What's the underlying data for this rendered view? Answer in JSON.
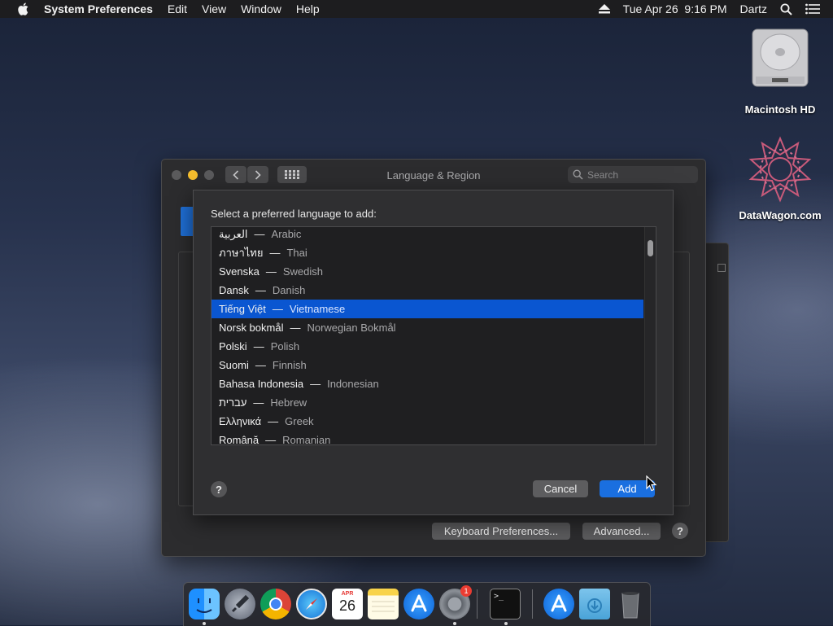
{
  "menubar": {
    "app_name": "System Preferences",
    "menus": [
      "Edit",
      "View",
      "Window",
      "Help"
    ],
    "datetime": "Tue Apr 26  9:16 PM",
    "user": "Dartz"
  },
  "desktop_icons": [
    {
      "label": "Macintosh HD",
      "icon": "hard-drive-icon"
    },
    {
      "label": "DataWagon.com",
      "icon": "datawagon-logo-icon"
    }
  ],
  "window": {
    "title": "Language & Region",
    "search_placeholder": "Search",
    "keyboard_prefs_label": "Keyboard Preferences...",
    "advanced_label": "Advanced...",
    "help_label": "?"
  },
  "sheet": {
    "prompt": "Select a preferred language to add:",
    "languages": [
      {
        "native": "العربية",
        "english": "Arabic"
      },
      {
        "native": "ภาษาไทย",
        "english": "Thai"
      },
      {
        "native": "Svenska",
        "english": "Swedish"
      },
      {
        "native": "Dansk",
        "english": "Danish"
      },
      {
        "native": "Tiếng Việt",
        "english": "Vietnamese",
        "selected": true
      },
      {
        "native": "Norsk bokmål",
        "english": "Norwegian Bokmål"
      },
      {
        "native": "Polski",
        "english": "Polish"
      },
      {
        "native": "Suomi",
        "english": "Finnish"
      },
      {
        "native": "Bahasa Indonesia",
        "english": "Indonesian"
      },
      {
        "native": "עברית",
        "english": "Hebrew"
      },
      {
        "native": "Ελληνικά",
        "english": "Greek"
      },
      {
        "native": "Română",
        "english": "Romanian"
      }
    ],
    "separator": "—",
    "help_label": "?",
    "cancel_label": "Cancel",
    "add_label": "Add"
  },
  "dock": {
    "apps": [
      "finder-icon",
      "launchpad-icon",
      "chrome-icon",
      "safari-icon",
      "calendar-icon",
      "notes-icon",
      "app-store-icon",
      "system-preferences-icon",
      "terminal-icon",
      "applications-folder-icon",
      "downloads-folder-icon",
      "trash-icon"
    ],
    "calendar_month": "APR",
    "calendar_day": "26",
    "prefs_badge": "1",
    "terminal_prompt": ">_"
  },
  "colors": {
    "selection": "#0a56d1",
    "add_button": "#1a6fe0",
    "close": "#5a5a5c",
    "minimize": "#f5bd2e",
    "zoom": "#5a5a5c"
  }
}
